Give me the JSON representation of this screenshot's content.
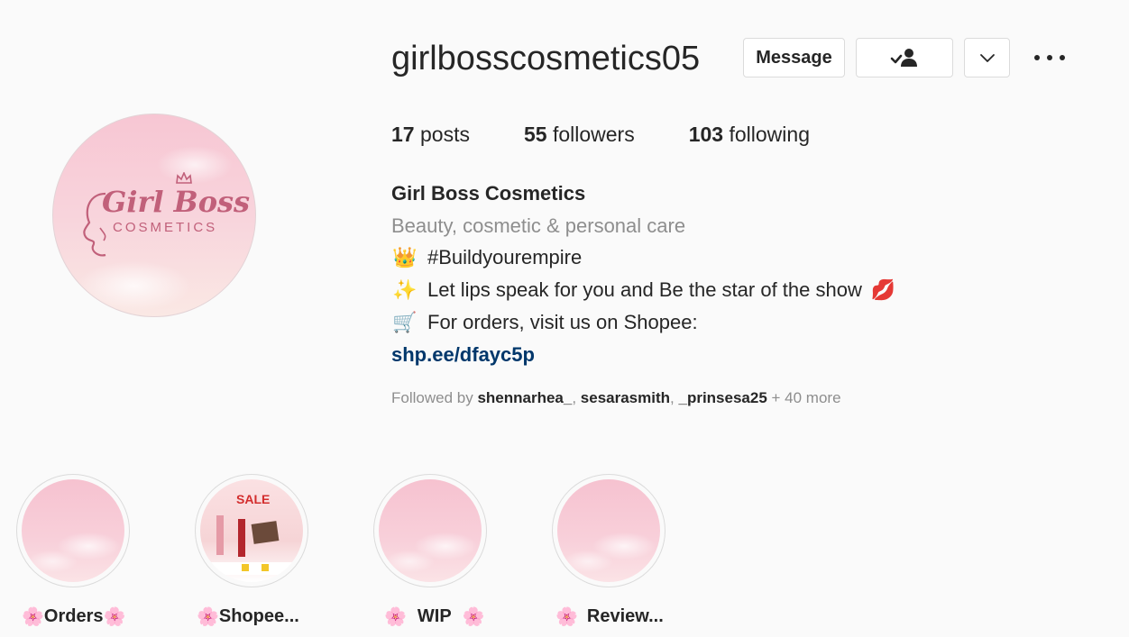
{
  "profile": {
    "username": "girlbosscosmetics05",
    "avatar_logo_title": "Girl Boss",
    "avatar_logo_sub": "COSMETICS",
    "buttons": {
      "message": "Message",
      "follow_icon": "person-check-icon",
      "dropdown_icon": "chevron-down-icon",
      "more_icon": "more-horizontal-icon"
    },
    "stats": {
      "posts_count": "17",
      "posts_label": "posts",
      "followers_count": "55",
      "followers_label": "followers",
      "following_count": "103",
      "following_label": "following"
    },
    "full_name": "Girl Boss Cosmetics",
    "category": "Beauty, cosmetic & personal care",
    "bio": [
      {
        "emoji": "👑",
        "text": "#Buildyourempire"
      },
      {
        "emoji": "✨",
        "text": "Let lips speak for you and Be the star of the show",
        "trailing_emoji": "💋"
      },
      {
        "emoji": "🛒",
        "text": "For orders, visit us on Shopee:"
      }
    ],
    "link": "shp.ee/dfayc5p",
    "followed_by": {
      "prefix": "Followed by",
      "users": [
        "shennarhea_",
        "sesarasmith",
        "_prinsesa25"
      ],
      "more": "+ 40 more"
    }
  },
  "highlights": [
    {
      "label": "Orders",
      "flower": "🌸"
    },
    {
      "label": "Shopee...",
      "flower": "🌸",
      "badge": "SALE"
    },
    {
      "label": "WIP",
      "flower": "🌸"
    },
    {
      "label": "Review...",
      "flower": "🌸"
    }
  ],
  "colors": {
    "background": "#fafafa",
    "text": "#262626",
    "secondary_text": "#8e8e8e",
    "link": "#00376b",
    "brand_pink": "#c1607a",
    "button_border": "#dbdbdb"
  }
}
